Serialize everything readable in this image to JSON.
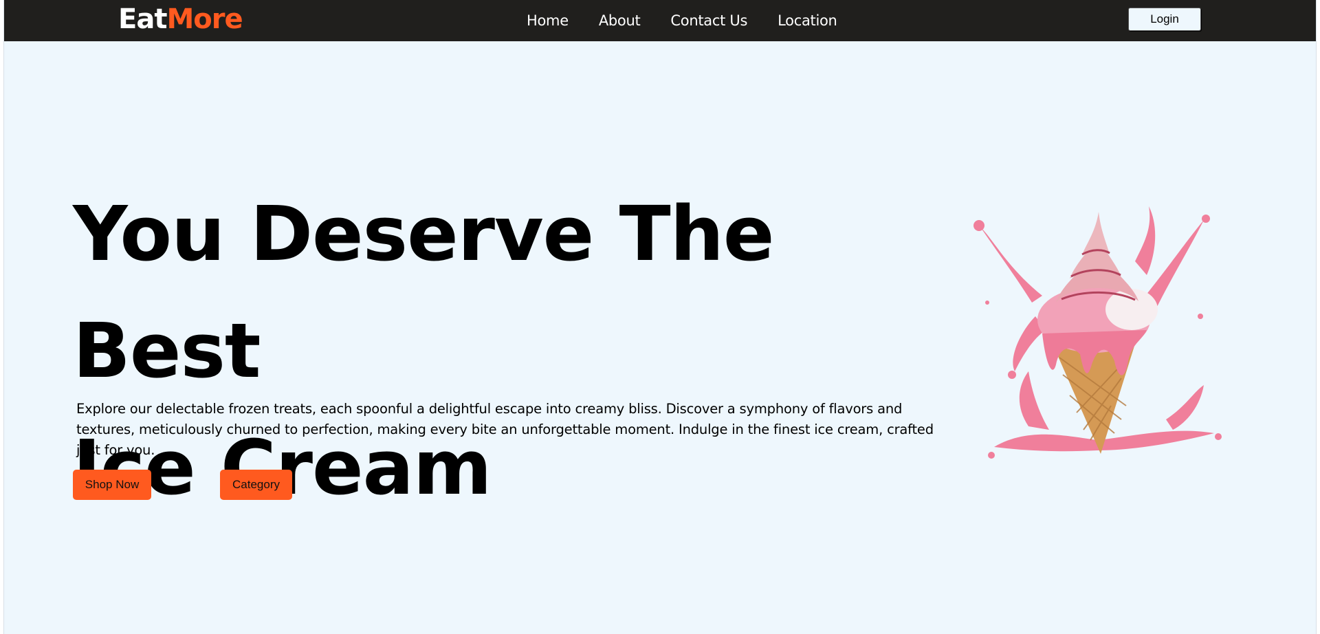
{
  "brand": {
    "part1": "Eat",
    "part2": "More"
  },
  "nav": {
    "items": [
      {
        "label": "Home"
      },
      {
        "label": "About"
      },
      {
        "label": "Contact Us"
      },
      {
        "label": "Location"
      }
    ],
    "login_label": "Login"
  },
  "hero": {
    "title_line1": "You Deserve The Best",
    "title_line2": "Ice Cream",
    "description": "Explore our delectable frozen treats, each spoonful a delightful escape into creamy bliss. Discover a symphony of flavors and textures, meticulously churned to perfection, making every bite an unforgettable moment. Indulge in the finest ice cream, crafted just for you.",
    "shop_label": "Shop Now",
    "category_label": "Category",
    "image": "ice-cream-cone-pink-splash"
  },
  "colors": {
    "navbar": "#201f1d",
    "accent": "#ff5a1f",
    "background": "#eef7fd",
    "ice_cream_pink": "#f07f9b",
    "cone": "#d59a55"
  }
}
